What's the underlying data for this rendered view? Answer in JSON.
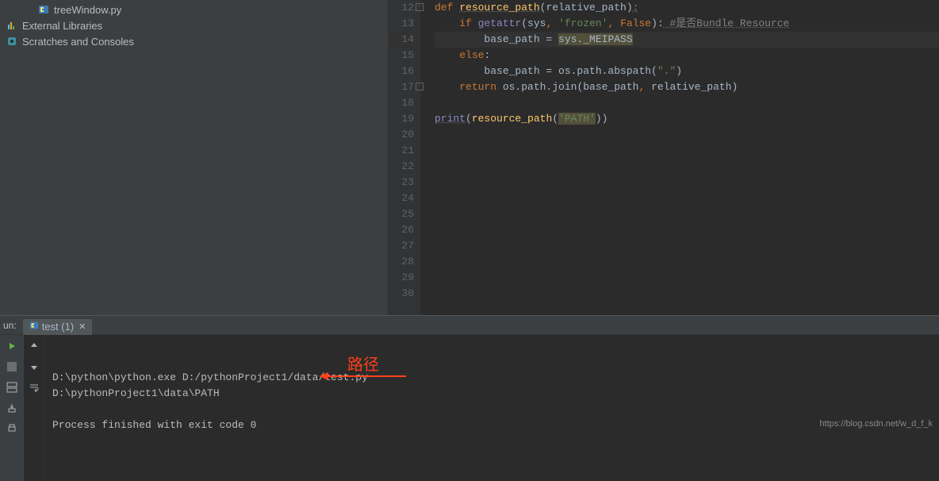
{
  "sidebar": {
    "items": [
      {
        "label": "treeWindow.py",
        "indent": true,
        "icon": "python-file-icon"
      },
      {
        "label": "External Libraries",
        "indent": false,
        "icon": "library-icon"
      },
      {
        "label": "Scratches and Consoles",
        "indent": false,
        "icon": "scratch-icon"
      }
    ]
  },
  "editor": {
    "first_line_number": 12,
    "last_line_number": 30,
    "lines": [
      {
        "n": 12,
        "fold": true,
        "segments": [
          [
            "kw",
            "def "
          ],
          [
            "fn under",
            "resource_path"
          ],
          [
            "pl",
            "(relative_path)"
          ],
          [
            "grey-under",
            ":"
          ]
        ]
      },
      {
        "n": 13,
        "segments": [
          [
            "pl",
            "    "
          ],
          [
            "kw",
            "if "
          ],
          [
            "bi",
            "getattr"
          ],
          [
            "pl",
            "(sys"
          ],
          [
            "kw",
            ", "
          ],
          [
            "str",
            "'frozen'"
          ],
          [
            "kw",
            ", False"
          ],
          [
            "pl",
            "):"
          ],
          [
            "grey-under",
            " #是否Bundle Resource"
          ]
        ]
      },
      {
        "n": 14,
        "sel": true,
        "segments": [
          [
            "pl",
            "        base_path = "
          ],
          [
            "warn",
            "sys._MEIPASS"
          ]
        ]
      },
      {
        "n": 15,
        "segments": [
          [
            "pl",
            "    "
          ],
          [
            "kw",
            "else"
          ],
          [
            "pl",
            ":"
          ]
        ]
      },
      {
        "n": 16,
        "segments": [
          [
            "pl",
            "        base_path = os.path.abspath("
          ],
          [
            "str",
            "\".\""
          ],
          [
            "pl",
            ")"
          ]
        ]
      },
      {
        "n": 17,
        "fold": true,
        "segments": [
          [
            "pl",
            "    "
          ],
          [
            "kw",
            "return "
          ],
          [
            "pl",
            "os.path.join(base_path"
          ],
          [
            "kw",
            ", "
          ],
          [
            "pl",
            "relative_path)"
          ]
        ]
      },
      {
        "n": 18,
        "segments": []
      },
      {
        "n": 19,
        "segments": [
          [
            "bi under",
            "print"
          ],
          [
            "pl",
            "("
          ],
          [
            "fn",
            "resource_path"
          ],
          [
            "pl",
            "("
          ],
          [
            "str warn",
            "'PATH'"
          ],
          [
            "pl",
            "))"
          ]
        ]
      },
      {
        "n": 20,
        "segments": []
      },
      {
        "n": 21,
        "segments": []
      },
      {
        "n": 22,
        "segments": []
      },
      {
        "n": 23,
        "segments": []
      },
      {
        "n": 24,
        "segments": []
      },
      {
        "n": 25,
        "segments": []
      },
      {
        "n": 26,
        "segments": []
      },
      {
        "n": 27,
        "segments": []
      },
      {
        "n": 28,
        "segments": []
      },
      {
        "n": 29,
        "segments": []
      },
      {
        "n": 30,
        "segments": []
      }
    ]
  },
  "run": {
    "panel_label": "un:",
    "tab_label": "test (1)",
    "console_lines": [
      "D:\\python\\python.exe D:/pythonProject1/data/test.py",
      "D:\\pythonProject1\\data\\PATH",
      "",
      "Process finished with exit code 0"
    ]
  },
  "annotation": {
    "text": "路径"
  },
  "watermark": "https://blog.csdn.net/w_d_f_k"
}
